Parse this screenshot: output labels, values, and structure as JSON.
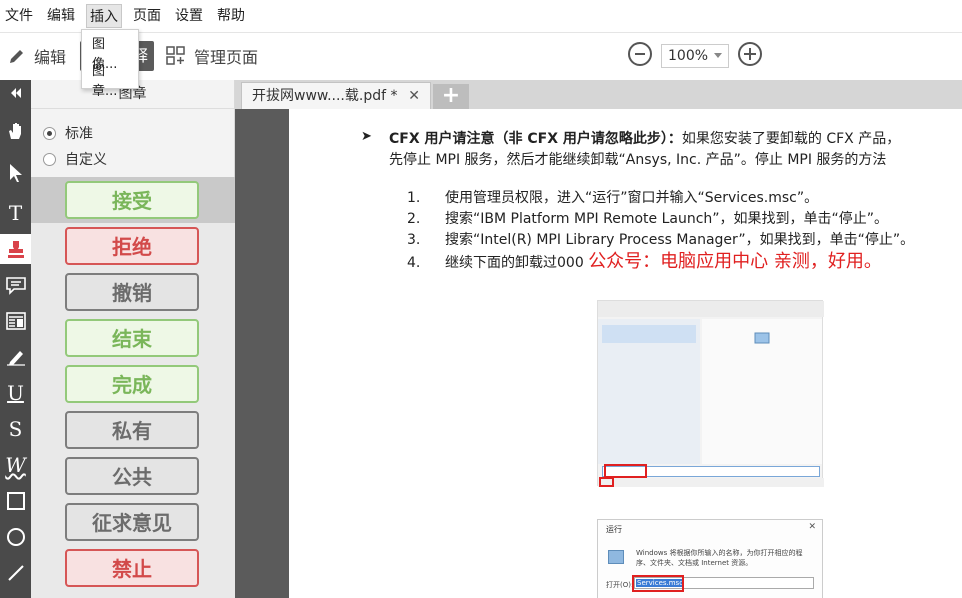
{
  "menubar": {
    "items": [
      "文件",
      "编辑",
      "插入",
      "页面",
      "设置",
      "帮助"
    ],
    "active_index": 2
  },
  "dropdown": {
    "items": [
      "图像...",
      "图章..."
    ]
  },
  "toolbar": {
    "edit_label": "编辑",
    "sign_label": "释",
    "manage_label": "管理页面",
    "zoom_value": "100%"
  },
  "toolstrip": {
    "icons": [
      "collapse-icon",
      "hand-icon",
      "select-arrow-icon",
      "text-icon",
      "stamp-icon",
      "comment-icon",
      "textbox-icon",
      "highlight-pen-icon",
      "underline-icon",
      "strikeout-icon",
      "squiggly-icon",
      "rectangle-icon",
      "ellipse-icon",
      "line-icon"
    ],
    "letters": {
      "text": "T",
      "underline": "U",
      "strike": "S",
      "squiggly": "W"
    },
    "selected": "stamp-icon"
  },
  "panel": {
    "title": "图章",
    "radio_standard": "标准",
    "radio_custom": "自定义",
    "radio_selected": "标准",
    "stamps": [
      {
        "label": "接受",
        "style": "green"
      },
      {
        "label": "拒绝",
        "style": "red"
      },
      {
        "label": "撤销",
        "style": "gray"
      },
      {
        "label": "结束",
        "style": "green"
      },
      {
        "label": "完成",
        "style": "green"
      },
      {
        "label": "私有",
        "style": "gray"
      },
      {
        "label": "公共",
        "style": "gray"
      },
      {
        "label": "征求意见",
        "style": "gray"
      },
      {
        "label": "禁止",
        "style": "red"
      }
    ]
  },
  "tabs": {
    "active_title": "开拔网www....载.pdf *",
    "close": "✕",
    "add": "+"
  },
  "document": {
    "intro_bold": "CFX 用户请注意（非 CFX 用户请忽略此步）：",
    "intro_rest": "如果您安装了要卸载的 CFX 产品，",
    "intro_line2": "先停止 MPI 服务，然后才能继续卸载“Ansys, Inc. 产品”。停止 MPI 服务的方法",
    "steps": [
      {
        "num": "1.",
        "text": "使用管理员权限，进入“运行”窗口并输入“Services.msc”。"
      },
      {
        "num": "2.",
        "text": "搜索“IBM Platform MPI Remote Launch”，如果找到，单击“停止”。"
      },
      {
        "num": "3.",
        "text": "搜索“Intel(R) MPI Library Process Manager”，如果找到，单击“停止”。"
      },
      {
        "num": "4.",
        "text": "继续下面的卸载过000"
      }
    ],
    "red_note": "公众号：电脑应用中心 亲测，好用。",
    "run_dialog": {
      "title": "运行",
      "description": "Windows 将根据你所输入的名称，为你打开相应的程序、文件夹、文档或 Internet 资源。",
      "open_label": "打开(O):",
      "open_value": "Services.msc"
    }
  }
}
